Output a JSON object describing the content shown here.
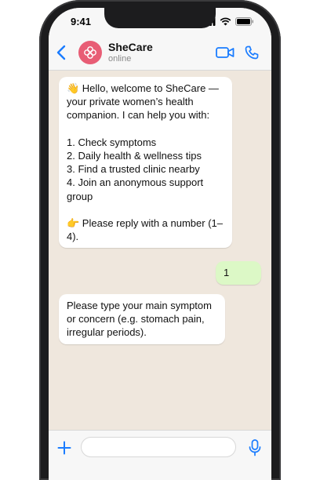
{
  "status_bar": {
    "time": "9:41"
  },
  "contact": {
    "name": "SheCare",
    "status": "online"
  },
  "messages": [
    {
      "direction": "incoming",
      "text": "👋 Hello, welcome to SheCare — your private women’s health companion. I can help you with:\n\n1. Check symptoms\n2. Daily health & wellness tips\n3. Find a trusted clinic nearby\n4. Join an anonymous support group\n\n👉 Please reply with a number (1–4)."
    },
    {
      "direction": "outgoing",
      "text": "1"
    },
    {
      "direction": "incoming",
      "text": "Please type your main symptom or concern (e.g. stomach pain, irregular periods)."
    }
  ],
  "composer": {
    "placeholder": "",
    "value": ""
  },
  "icons": {
    "back": "chevron-left-icon",
    "avatar": "flower-logo-icon",
    "video": "video-camera-icon",
    "call": "phone-icon",
    "attach": "plus-icon",
    "mic": "microphone-icon"
  },
  "colors": {
    "accent": "#1a7cff",
    "avatar": "#e85d75",
    "outgoing_bubble": "#dcf8c6",
    "chat_background": "#efe7dd"
  }
}
